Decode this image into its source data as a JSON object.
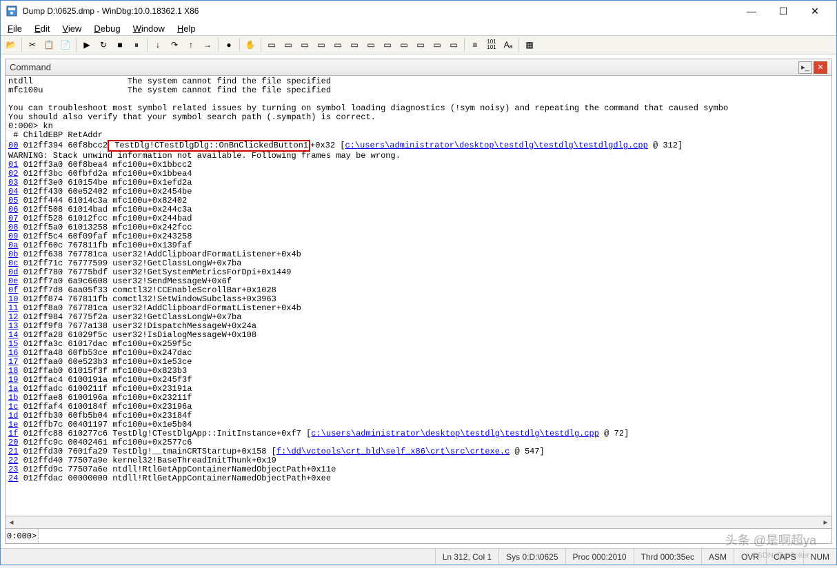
{
  "window": {
    "title": "Dump D:\\0625.dmp - WinDbg:10.0.18362.1 X86"
  },
  "menu": {
    "file": "File",
    "edit": "Edit",
    "view": "View",
    "debug": "Debug",
    "window": "Window",
    "help": "Help"
  },
  "command": {
    "panel_title": "Command",
    "prompt": "0:000>",
    "input_value": ""
  },
  "output": {
    "pre1": "ntdll                   The system cannot find the file specified\nmfc100u                 The system cannot find the file specified\n\nYou can troubleshoot most symbol related issues by turning on symbol loading diagnostics (!sym noisy) and repeating the command that caused symbo\nYou should also verify that your symbol search path (.sympath) is correct.\n0:000> kn\n # ChildEBP RetAddr ",
    "line00_num": "00",
    "line00_a": " 012ff394 60f8bcc2",
    "line00_box": " TestDlg!CTestDlgDlg::OnBnClickedButton1",
    "line00_b": "+0x32 [",
    "line00_link": "c:\\users\\administrator\\desktop\\testdlg\\testdlg\\testdlgdlg.cpp",
    "line00_c": " @ 312]",
    "warning": "WARNING: Stack unwind information not available. Following frames may be wrong.",
    "frames": [
      {
        "n": "01",
        "t": " 012ff3a0 60f8bea4 mfc100u+0x1bbcc2"
      },
      {
        "n": "02",
        "t": " 012ff3bc 60fbfd2a mfc100u+0x1bbea4"
      },
      {
        "n": "03",
        "t": " 012ff3e0 610154be mfc100u+0x1efd2a"
      },
      {
        "n": "04",
        "t": " 012ff430 60e52402 mfc100u+0x2454be"
      },
      {
        "n": "05",
        "t": " 012ff444 61014c3a mfc100u+0x82402"
      },
      {
        "n": "06",
        "t": " 012ff508 61014bad mfc100u+0x244c3a"
      },
      {
        "n": "07",
        "t": " 012ff528 61012fcc mfc100u+0x244bad"
      },
      {
        "n": "08",
        "t": " 012ff5a0 61013258 mfc100u+0x242fcc"
      },
      {
        "n": "09",
        "t": " 012ff5c4 60f09faf mfc100u+0x243258"
      },
      {
        "n": "0a",
        "t": " 012ff60c 767811fb mfc100u+0x139faf"
      },
      {
        "n": "0b",
        "t": " 012ff638 767781ca user32!AddClipboardFormatListener+0x4b"
      },
      {
        "n": "0c",
        "t": " 012ff71c 76777599 user32!GetClassLongW+0x7ba"
      },
      {
        "n": "0d",
        "t": " 012ff780 76775bdf user32!GetSystemMetricsForDpi+0x1449"
      },
      {
        "n": "0e",
        "t": " 012ff7a0 6a9c6608 user32!SendMessageW+0x6f"
      },
      {
        "n": "0f",
        "t": " 012ff7d8 6aa05f33 comctl32!CCEnableScrollBar+0x1028"
      },
      {
        "n": "10",
        "t": " 012ff874 767811fb comctl32!SetWindowSubclass+0x3963"
      },
      {
        "n": "11",
        "t": " 012ff8a0 767781ca user32!AddClipboardFormatListener+0x4b"
      },
      {
        "n": "12",
        "t": " 012ff984 76775f2a user32!GetClassLongW+0x7ba"
      },
      {
        "n": "13",
        "t": " 012ff9f8 7677a138 user32!DispatchMessageW+0x24a"
      },
      {
        "n": "14",
        "t": " 012ffa28 61029f5c user32!IsDialogMessageW+0x108"
      },
      {
        "n": "15",
        "t": " 012ffa3c 61017dac mfc100u+0x259f5c"
      },
      {
        "n": "16",
        "t": " 012ffa48 60fb53ce mfc100u+0x247dac"
      },
      {
        "n": "17",
        "t": " 012ffaa0 60e523b3 mfc100u+0x1e53ce"
      },
      {
        "n": "18",
        "t": " 012ffab0 61015f3f mfc100u+0x823b3"
      },
      {
        "n": "19",
        "t": " 012ffac4 6100191a mfc100u+0x245f3f"
      },
      {
        "n": "1a",
        "t": " 012ffadc 6100211f mfc100u+0x23191a"
      },
      {
        "n": "1b",
        "t": " 012ffae8 6100196a mfc100u+0x23211f"
      },
      {
        "n": "1c",
        "t": " 012ffaf4 6100184f mfc100u+0x23196a"
      },
      {
        "n": "1d",
        "t": " 012ffb30 60fb5b04 mfc100u+0x23184f"
      },
      {
        "n": "1e",
        "t": " 012ffb7c 00401197 mfc100u+0x1e5b04"
      }
    ],
    "line1f_num": "1f",
    "line1f_a": " 012ffc88 610277c6 TestDlg!CTestDlgApp::InitInstance+0xf7 [",
    "line1f_link": "c:\\users\\administrator\\desktop\\testdlg\\testdlg\\testdlg.cpp",
    "line1f_b": " @ 72]",
    "line20": " 012ffc9c 00402461 mfc100u+0x2577c6",
    "line21_num": "21",
    "line21_a": " 012ffd30 7601fa29 TestDlg!__tmainCRTStartup+0x158 [",
    "line21_link": "f:\\dd\\vctools\\crt_bld\\self_x86\\crt\\src\\crtexe.c",
    "line21_b": " @ 547]",
    "line22": " 012ffd40 77507a9e kernel32!BaseThreadInitThunk+0x19",
    "line23": " 012ffd9c 77507a6e ntdll!RtlGetAppContainerNamedObjectPath+0x11e",
    "line24": " 012ffdac 00000000 ntdll!RtlGetAppContainerNamedObjectPath+0xee",
    "n20": "20",
    "n22": "22",
    "n23": "23",
    "n24": "24"
  },
  "status": {
    "ln": "Ln 312, Col 1",
    "sys": "Sys 0:D:\\0625",
    "proc": "Proc 000:2010",
    "thrd": "Thrd 000:35ec",
    "asm": "ASM",
    "ovr": "OVR",
    "caps": "CAPS",
    "num": "NUM"
  },
  "watermark": "头条 @是啊超ya",
  "watermark2": "CSDN @dvlinker"
}
